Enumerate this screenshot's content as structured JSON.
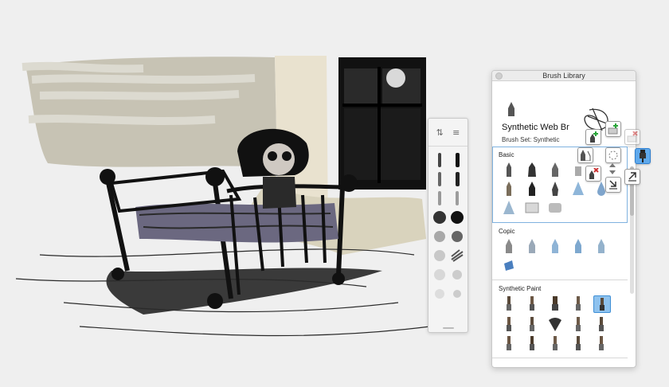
{
  "app": {
    "accent_color": "#5fa9ec",
    "selection_color": "#7fb2e0"
  },
  "mini_panel": {
    "header_icons": [
      "sliders-icon",
      "menu-icon"
    ],
    "brush_icons": [
      "pencil-stroke",
      "dark-stroke",
      "soft-stroke",
      "ink-stroke",
      "gray-stroke",
      "chalk-stroke",
      "splatter-brush",
      "texture-brush",
      "speckle-brush",
      "noise-brush",
      "cloud-brush",
      "crosshatch-brush",
      "light-cloud-brush",
      "light-texture-brush",
      "faint-brush",
      "faint-texture-brush"
    ]
  },
  "library": {
    "title": "Brush Library",
    "current_brush": {
      "name": "Synthetic Web Br",
      "set": "Brush Set: Synthetic"
    },
    "sets": [
      {
        "label": "Basic",
        "brushes": [
          "pencil",
          "marker",
          "pen",
          "eraser",
          "felt-tip",
          "airbrush",
          "pointed-pen",
          "ink",
          "cone",
          "droplet",
          "triangle-tool",
          "blender",
          "gray-marker"
        ]
      },
      {
        "label": "Copic",
        "brushes": [
          "copic-1",
          "copic-2",
          "copic-3",
          "copic-4",
          "copic-5",
          "copic-box"
        ]
      },
      {
        "label": "Synthetic Paint",
        "brushes": [
          "paint-1",
          "paint-2",
          "paint-3",
          "paint-4",
          "paint-5-selected",
          "paint-6",
          "paint-7",
          "fan-brush",
          "paint-9",
          "paint-10",
          "paint-11",
          "paint-12",
          "paint-13",
          "paint-14",
          "paint-15"
        ]
      }
    ]
  },
  "floating_tools": [
    "add-brush",
    "add-set",
    "remove-brush-disabled",
    "duplicate-brush",
    "brush-properties",
    "pin-brush",
    "delete-brush",
    "reorder",
    "import-brush",
    "export-brush"
  ]
}
